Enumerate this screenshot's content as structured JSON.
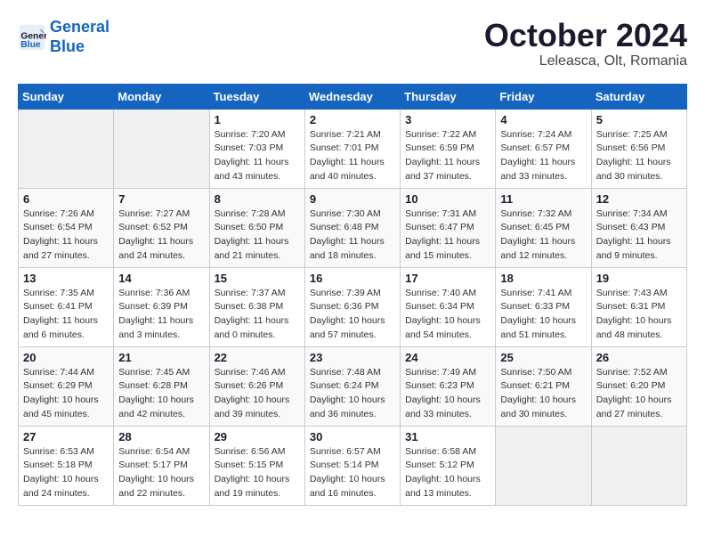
{
  "header": {
    "logo": {
      "line1": "General",
      "line2": "Blue"
    },
    "title": "October 2024",
    "location": "Leleasca, Olt, Romania"
  },
  "columns": [
    "Sunday",
    "Monday",
    "Tuesday",
    "Wednesday",
    "Thursday",
    "Friday",
    "Saturday"
  ],
  "weeks": [
    {
      "days": [
        {
          "num": "",
          "empty": true
        },
        {
          "num": "",
          "empty": true
        },
        {
          "num": "1",
          "sunrise": "Sunrise: 7:20 AM",
          "sunset": "Sunset: 7:03 PM",
          "daylight": "Daylight: 11 hours and 43 minutes."
        },
        {
          "num": "2",
          "sunrise": "Sunrise: 7:21 AM",
          "sunset": "Sunset: 7:01 PM",
          "daylight": "Daylight: 11 hours and 40 minutes."
        },
        {
          "num": "3",
          "sunrise": "Sunrise: 7:22 AM",
          "sunset": "Sunset: 6:59 PM",
          "daylight": "Daylight: 11 hours and 37 minutes."
        },
        {
          "num": "4",
          "sunrise": "Sunrise: 7:24 AM",
          "sunset": "Sunset: 6:57 PM",
          "daylight": "Daylight: 11 hours and 33 minutes."
        },
        {
          "num": "5",
          "sunrise": "Sunrise: 7:25 AM",
          "sunset": "Sunset: 6:56 PM",
          "daylight": "Daylight: 11 hours and 30 minutes."
        }
      ]
    },
    {
      "days": [
        {
          "num": "6",
          "sunrise": "Sunrise: 7:26 AM",
          "sunset": "Sunset: 6:54 PM",
          "daylight": "Daylight: 11 hours and 27 minutes."
        },
        {
          "num": "7",
          "sunrise": "Sunrise: 7:27 AM",
          "sunset": "Sunset: 6:52 PM",
          "daylight": "Daylight: 11 hours and 24 minutes."
        },
        {
          "num": "8",
          "sunrise": "Sunrise: 7:28 AM",
          "sunset": "Sunset: 6:50 PM",
          "daylight": "Daylight: 11 hours and 21 minutes."
        },
        {
          "num": "9",
          "sunrise": "Sunrise: 7:30 AM",
          "sunset": "Sunset: 6:48 PM",
          "daylight": "Daylight: 11 hours and 18 minutes."
        },
        {
          "num": "10",
          "sunrise": "Sunrise: 7:31 AM",
          "sunset": "Sunset: 6:47 PM",
          "daylight": "Daylight: 11 hours and 15 minutes."
        },
        {
          "num": "11",
          "sunrise": "Sunrise: 7:32 AM",
          "sunset": "Sunset: 6:45 PM",
          "daylight": "Daylight: 11 hours and 12 minutes."
        },
        {
          "num": "12",
          "sunrise": "Sunrise: 7:34 AM",
          "sunset": "Sunset: 6:43 PM",
          "daylight": "Daylight: 11 hours and 9 minutes."
        }
      ]
    },
    {
      "days": [
        {
          "num": "13",
          "sunrise": "Sunrise: 7:35 AM",
          "sunset": "Sunset: 6:41 PM",
          "daylight": "Daylight: 11 hours and 6 minutes."
        },
        {
          "num": "14",
          "sunrise": "Sunrise: 7:36 AM",
          "sunset": "Sunset: 6:39 PM",
          "daylight": "Daylight: 11 hours and 3 minutes."
        },
        {
          "num": "15",
          "sunrise": "Sunrise: 7:37 AM",
          "sunset": "Sunset: 6:38 PM",
          "daylight": "Daylight: 11 hours and 0 minutes."
        },
        {
          "num": "16",
          "sunrise": "Sunrise: 7:39 AM",
          "sunset": "Sunset: 6:36 PM",
          "daylight": "Daylight: 10 hours and 57 minutes."
        },
        {
          "num": "17",
          "sunrise": "Sunrise: 7:40 AM",
          "sunset": "Sunset: 6:34 PM",
          "daylight": "Daylight: 10 hours and 54 minutes."
        },
        {
          "num": "18",
          "sunrise": "Sunrise: 7:41 AM",
          "sunset": "Sunset: 6:33 PM",
          "daylight": "Daylight: 10 hours and 51 minutes."
        },
        {
          "num": "19",
          "sunrise": "Sunrise: 7:43 AM",
          "sunset": "Sunset: 6:31 PM",
          "daylight": "Daylight: 10 hours and 48 minutes."
        }
      ]
    },
    {
      "days": [
        {
          "num": "20",
          "sunrise": "Sunrise: 7:44 AM",
          "sunset": "Sunset: 6:29 PM",
          "daylight": "Daylight: 10 hours and 45 minutes."
        },
        {
          "num": "21",
          "sunrise": "Sunrise: 7:45 AM",
          "sunset": "Sunset: 6:28 PM",
          "daylight": "Daylight: 10 hours and 42 minutes."
        },
        {
          "num": "22",
          "sunrise": "Sunrise: 7:46 AM",
          "sunset": "Sunset: 6:26 PM",
          "daylight": "Daylight: 10 hours and 39 minutes."
        },
        {
          "num": "23",
          "sunrise": "Sunrise: 7:48 AM",
          "sunset": "Sunset: 6:24 PM",
          "daylight": "Daylight: 10 hours and 36 minutes."
        },
        {
          "num": "24",
          "sunrise": "Sunrise: 7:49 AM",
          "sunset": "Sunset: 6:23 PM",
          "daylight": "Daylight: 10 hours and 33 minutes."
        },
        {
          "num": "25",
          "sunrise": "Sunrise: 7:50 AM",
          "sunset": "Sunset: 6:21 PM",
          "daylight": "Daylight: 10 hours and 30 minutes."
        },
        {
          "num": "26",
          "sunrise": "Sunrise: 7:52 AM",
          "sunset": "Sunset: 6:20 PM",
          "daylight": "Daylight: 10 hours and 27 minutes."
        }
      ]
    },
    {
      "days": [
        {
          "num": "27",
          "sunrise": "Sunrise: 6:53 AM",
          "sunset": "Sunset: 5:18 PM",
          "daylight": "Daylight: 10 hours and 24 minutes."
        },
        {
          "num": "28",
          "sunrise": "Sunrise: 6:54 AM",
          "sunset": "Sunset: 5:17 PM",
          "daylight": "Daylight: 10 hours and 22 minutes."
        },
        {
          "num": "29",
          "sunrise": "Sunrise: 6:56 AM",
          "sunset": "Sunset: 5:15 PM",
          "daylight": "Daylight: 10 hours and 19 minutes."
        },
        {
          "num": "30",
          "sunrise": "Sunrise: 6:57 AM",
          "sunset": "Sunset: 5:14 PM",
          "daylight": "Daylight: 10 hours and 16 minutes."
        },
        {
          "num": "31",
          "sunrise": "Sunrise: 6:58 AM",
          "sunset": "Sunset: 5:12 PM",
          "daylight": "Daylight: 10 hours and 13 minutes."
        },
        {
          "num": "",
          "empty": true
        },
        {
          "num": "",
          "empty": true
        }
      ]
    }
  ]
}
